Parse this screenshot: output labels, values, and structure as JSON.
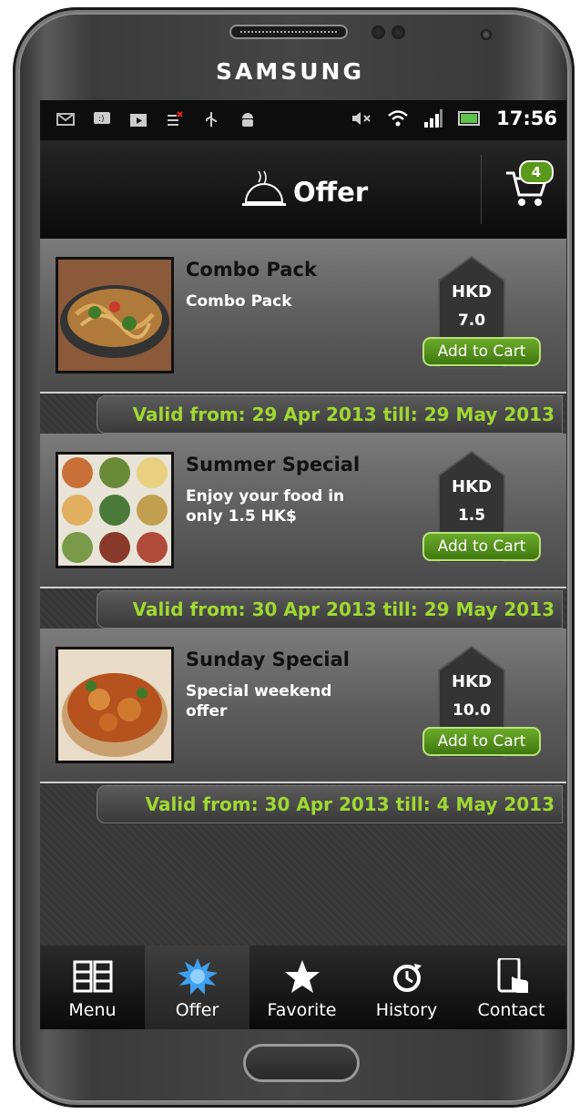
{
  "device": {
    "brand": "SAMSUNG"
  },
  "status_bar": {
    "time": "17:56",
    "icons": [
      "mail-icon",
      "chat-icon",
      "store-icon",
      "notification-icon",
      "usb-icon",
      "android-icon",
      "mute-icon",
      "wifi-icon",
      "signal-icon",
      "battery-icon"
    ]
  },
  "header": {
    "title": "Offer",
    "cart_count": "4"
  },
  "offers": [
    {
      "name": "Combo Pack",
      "description": "Combo Pack",
      "currency": "HKD",
      "price": "7.0",
      "button": "Add to Cart",
      "valid": "Valid from: 29 Apr 2013 till: 29 May 2013"
    },
    {
      "name": "Summer Special",
      "description": "Enjoy your food in only 1.5 HK$",
      "currency": "HKD",
      "price": "1.5",
      "button": "Add to Cart",
      "valid": "Valid from: 30 Apr 2013 till: 29 May 2013"
    },
    {
      "name": "Sunday Special",
      "description": "Special weekend offer",
      "currency": "HKD",
      "price": "10.0",
      "button": "Add to Cart",
      "valid": "Valid from: 30 Apr 2013 till: 4 May 2013"
    }
  ],
  "tabs": [
    {
      "label": "Menu",
      "icon": "menu-grid-icon"
    },
    {
      "label": "Offer",
      "icon": "starburst-icon",
      "active": true
    },
    {
      "label": "Favorite",
      "icon": "star-icon"
    },
    {
      "label": "History",
      "icon": "clock-icon"
    },
    {
      "label": "Contact",
      "icon": "phone-touch-icon"
    }
  ],
  "colors": {
    "accent_green": "#9fd832",
    "button_green": "#5a9a1a",
    "active_tab": "#3d3d3d"
  }
}
